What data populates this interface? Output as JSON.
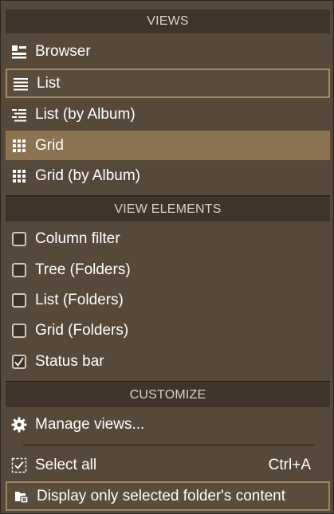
{
  "sections": {
    "views": "VIEWS",
    "view_elements": "VIEW ELEMENTS",
    "customize": "CUSTOMIZE"
  },
  "views": [
    {
      "label": "Browser",
      "icon": "browser-layout-icon"
    },
    {
      "label": "List",
      "icon": "list-icon",
      "state": "outlined"
    },
    {
      "label": "List (by Album)",
      "icon": "list-grouped-icon"
    },
    {
      "label": "Grid",
      "icon": "grid-icon",
      "state": "selected"
    },
    {
      "label": "Grid (by Album)",
      "icon": "grid-icon"
    }
  ],
  "view_elements": [
    {
      "label": "Column filter",
      "checked": false
    },
    {
      "label": "Tree (Folders)",
      "checked": false
    },
    {
      "label": "List (Folders)",
      "checked": false
    },
    {
      "label": "Grid (Folders)",
      "checked": false
    },
    {
      "label": "Status bar",
      "checked": true
    }
  ],
  "customize": {
    "manage_views": "Manage views...",
    "select_all": "Select all",
    "select_all_shortcut": "Ctrl+A",
    "display_selected": "Display only selected folder's content"
  },
  "colors": {
    "menu_bg": "#56493a",
    "header_bg": "#40342a",
    "selected_bg": "#8c7351",
    "outline": "#a08c69"
  }
}
